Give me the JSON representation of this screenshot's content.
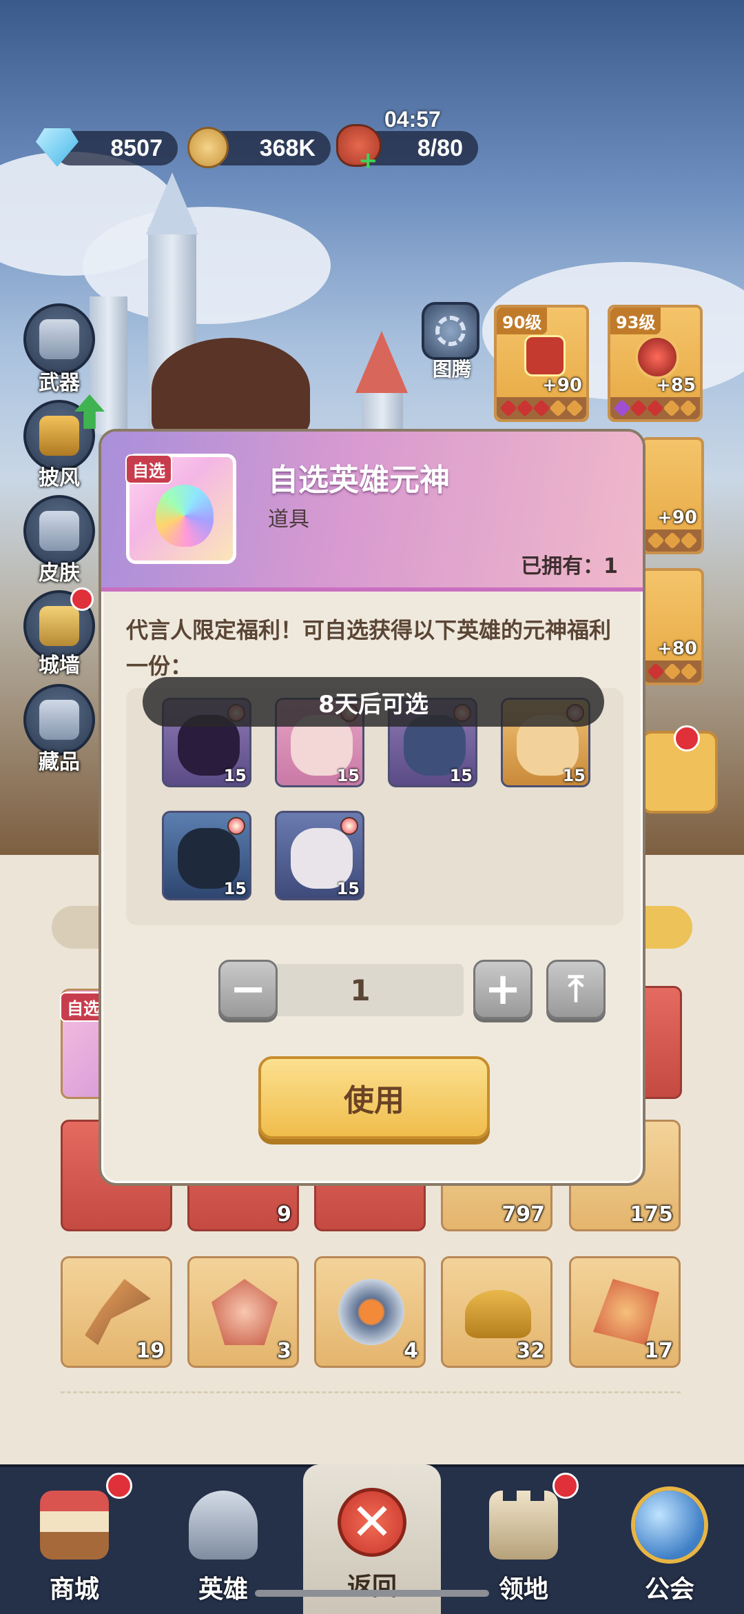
{
  "status": {
    "diamonds": "8507",
    "coins": "368K",
    "stamina_timer": "04:57",
    "stamina": "8/80"
  },
  "side_menu": [
    "武器",
    "披风",
    "皮肤",
    "城墙",
    "藏品"
  ],
  "totem_label": "图腾",
  "gear": [
    {
      "level": "90级",
      "plus": "+90"
    },
    {
      "level": "93级",
      "plus": "+85"
    },
    {
      "plus": "+90"
    },
    {
      "plus": "+80"
    }
  ],
  "inventory": {
    "row1_counts": [
      "9",
      "797",
      "175"
    ],
    "row2_counts": [
      "19",
      "3",
      "4",
      "32",
      "17"
    ],
    "tag": "自选"
  },
  "dialog": {
    "tag": "自选",
    "title": "自选英雄元神",
    "subtitle": "道具",
    "owned": "已拥有：1",
    "description": "代言人限定福利！可自选获得以下英雄的元神福利一份：",
    "lock_banner": "8天后可选",
    "heroes": [
      {
        "level": "15"
      },
      {
        "level": "15"
      },
      {
        "level": "15"
      },
      {
        "level": "15"
      },
      {
        "level": "15"
      },
      {
        "level": "15"
      }
    ],
    "quantity": "1",
    "minus_glyph": "−",
    "plus_glyph": "+",
    "max_glyph": "⤒",
    "use_label": "使用"
  },
  "nav": {
    "shop": "商城",
    "heroes": "英雄",
    "back": "返回",
    "back_glyph": "✕",
    "territory": "领地",
    "guild": "公会"
  }
}
